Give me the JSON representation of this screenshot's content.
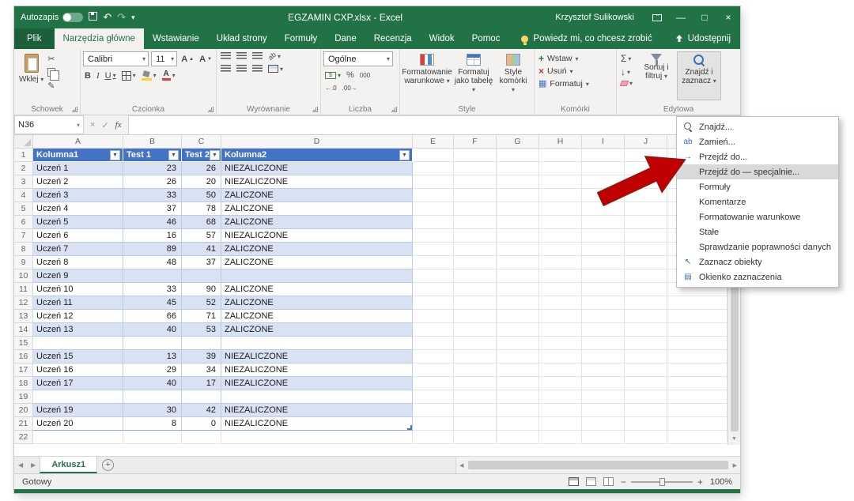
{
  "titlebar": {
    "autosave": "Autozapis",
    "title": "EGZAMIN CXP.xlsx - Excel",
    "user": "Krzysztof Sulikowski"
  },
  "tabs": {
    "file": "Plik",
    "items": [
      "Narzędzia główne",
      "Wstawianie",
      "Układ strony",
      "Formuły",
      "Dane",
      "Recenzja",
      "Widok",
      "Pomoc"
    ],
    "active": "Narzędzia główne",
    "tellme": "Powiedz mi, co chcesz zrobić",
    "share": "Udostępnij"
  },
  "ribbon": {
    "paste": "Wklej",
    "font_name": "Calibri",
    "font_size": "11",
    "number_format": "Ogólne",
    "style_buttons": [
      "Formatowanie warunkowe",
      "Formatuj jako tabelę",
      "Style komórki"
    ],
    "cell_buttons": [
      "Wstaw",
      "Usuń",
      "Formatuj"
    ],
    "sort_filter": "Sortuj i filtruj",
    "find_select": "Znajdź i zaznacz",
    "groups": {
      "clipboard": "Schowek",
      "font": "Czcionka",
      "alignment": "Wyrównanie",
      "number": "Liczba",
      "styles": "Style",
      "cells": "Komórki",
      "editing": "Edytowa"
    }
  },
  "formula_bar": {
    "name_box": "N36",
    "fx_label": "fx",
    "value": ""
  },
  "grid": {
    "columns": [
      "A",
      "B",
      "C",
      "D",
      "E",
      "F",
      "G",
      "H",
      "I",
      "J"
    ],
    "row_count": 22,
    "table": {
      "headers": [
        "Kolumna1",
        "Test 1",
        "Test 2",
        "Kolumna2"
      ],
      "rows": [
        {
          "row": 2,
          "cells": [
            "Uczeń 1",
            "23",
            "26",
            "NIEZALICZONE"
          ]
        },
        {
          "row": 3,
          "cells": [
            "Uczeń 2",
            "26",
            "20",
            "NIEZALICZONE"
          ]
        },
        {
          "row": 4,
          "cells": [
            "Uczeń 3",
            "33",
            "50",
            "ZALICZONE"
          ]
        },
        {
          "row": 5,
          "cells": [
            "Uczeń 4",
            "37",
            "78",
            "ZALICZONE"
          ]
        },
        {
          "row": 6,
          "cells": [
            "Uczeń 5",
            "46",
            "68",
            "ZALICZONE"
          ]
        },
        {
          "row": 7,
          "cells": [
            "Uczeń 6",
            "16",
            "57",
            "NIEZALICZONE"
          ]
        },
        {
          "row": 8,
          "cells": [
            "Uczeń 7",
            "89",
            "41",
            "ZALICZONE"
          ]
        },
        {
          "row": 9,
          "cells": [
            "Uczeń 8",
            "48",
            "37",
            "ZALICZONE"
          ]
        },
        {
          "row": 10,
          "cells": [
            "Uczeń 9",
            "",
            "",
            ""
          ]
        },
        {
          "row": 11,
          "cells": [
            "Uczeń 10",
            "33",
            "90",
            "ZALICZONE"
          ]
        },
        {
          "row": 12,
          "cells": [
            "Uczeń 11",
            "45",
            "52",
            "ZALICZONE"
          ]
        },
        {
          "row": 13,
          "cells": [
            "Uczeń 12",
            "66",
            "71",
            "ZALICZONE"
          ]
        },
        {
          "row": 14,
          "cells": [
            "Uczeń 13",
            "40",
            "53",
            "ZALICZONE"
          ]
        },
        {
          "row": 15,
          "cells": [
            "",
            "",
            "",
            ""
          ]
        },
        {
          "row": 16,
          "cells": [
            "Uczeń 15",
            "13",
            "39",
            "NIEZALICZONE"
          ]
        },
        {
          "row": 17,
          "cells": [
            "Uczeń 16",
            "29",
            "34",
            "NIEZALICZONE"
          ]
        },
        {
          "row": 18,
          "cells": [
            "Uczeń 17",
            "40",
            "17",
            "NIEZALICZONE"
          ]
        },
        {
          "row": 19,
          "cells": [
            "",
            "",
            "",
            ""
          ]
        },
        {
          "row": 20,
          "cells": [
            "Uczeń 19",
            "30",
            "42",
            "NIEZALICZONE"
          ]
        },
        {
          "row": 21,
          "cells": [
            "Uczeń 20",
            "8",
            "0",
            "NIEZALICZONE"
          ]
        }
      ]
    }
  },
  "find_menu": {
    "items": [
      {
        "label": "Znajdź...",
        "icon": "find-icon"
      },
      {
        "label": "Zamień...",
        "icon": "replace-icon"
      },
      {
        "label": "Przejdź do...",
        "icon": "goto-icon"
      },
      {
        "label": "Przejdź do — specjalnie...",
        "highlighted": true
      },
      {
        "label": "Formuły"
      },
      {
        "label": "Komentarze"
      },
      {
        "label": "Formatowanie warunkowe"
      },
      {
        "label": "Stałe"
      },
      {
        "label": "Sprawdzanie poprawności danych"
      },
      {
        "label": "Zaznacz obiekty",
        "icon": "select-objects-icon"
      },
      {
        "label": "Okienko zaznaczenia",
        "icon": "selection-pane-icon"
      }
    ]
  },
  "sheet_bar": {
    "active_tab": "Arkusz1"
  },
  "status_bar": {
    "status": "Gotowy",
    "zoom": "100%"
  },
  "colors": {
    "excel_green": "#217346",
    "table_header": "#4472c4",
    "band": "#d9e2f3",
    "arrow_red": "#c00000"
  }
}
